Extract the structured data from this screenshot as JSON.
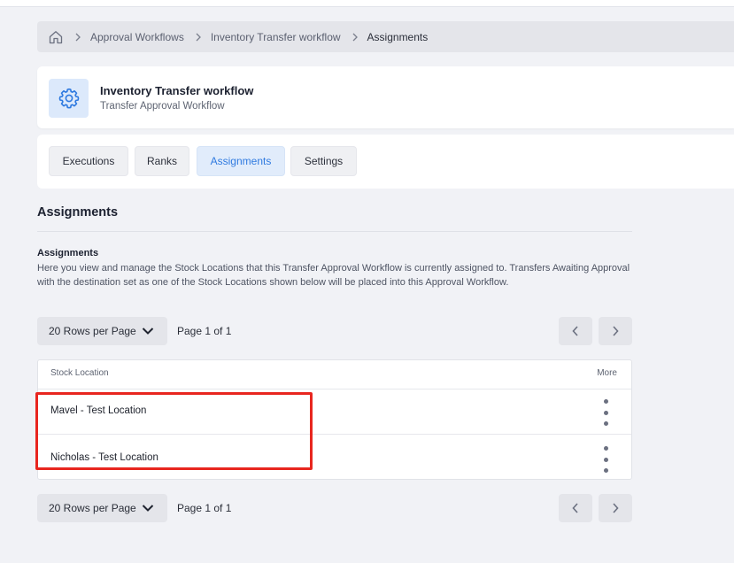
{
  "breadcrumb": {
    "items": [
      "Approval Workflows",
      "Inventory Transfer workflow",
      "Assignments"
    ]
  },
  "header": {
    "title": "Inventory Transfer workflow",
    "subtitle": "Transfer Approval Workflow",
    "icon": "gear-icon",
    "accent": "#2f7ae0"
  },
  "tabs": [
    {
      "label": "Executions",
      "active": false
    },
    {
      "label": "Ranks",
      "active": false
    },
    {
      "label": "Assignments",
      "active": true
    },
    {
      "label": "Settings",
      "active": false
    }
  ],
  "section": {
    "title": "Assignments",
    "subtitle": "Assignments",
    "description": "Here you view and manage the Stock Locations that this Transfer Approval Workflow is currently assigned to. Transfers Awaiting Approval with the destination set as one of the Stock Locations shown below will be placed into this Approval Workflow."
  },
  "pagination_top": {
    "rows_per_page": "20 Rows per Page",
    "page": "Page 1 of 1"
  },
  "pagination_bottom": {
    "rows_per_page": "20 Rows per Page",
    "page": "Page 1 of 1"
  },
  "table": {
    "columns": [
      "Stock Location",
      "More"
    ],
    "rows": [
      {
        "location": "Mavel - Test Location"
      },
      {
        "location": "Nicholas - Test Location"
      }
    ]
  },
  "highlight_color": "#e8261f"
}
